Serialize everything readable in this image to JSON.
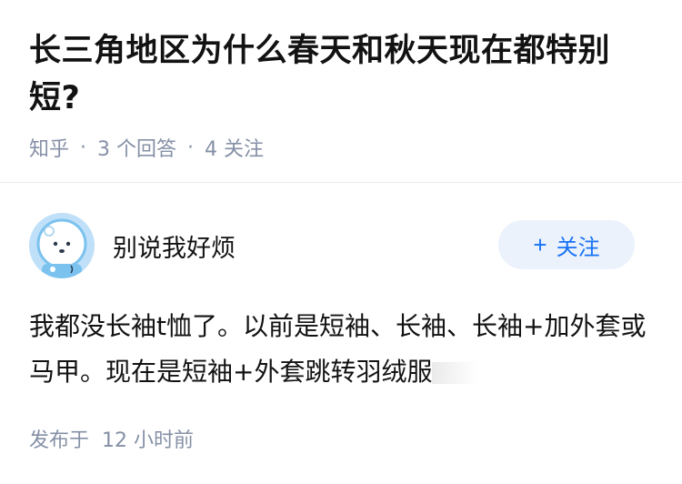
{
  "question": {
    "title": "长三角地区为什么春天和秋天现在都特别短?",
    "source": "知乎",
    "answer_count": "3 个回答",
    "follow_count": "4 关注"
  },
  "author": {
    "name": "别说我好烦",
    "follow_label": "关注",
    "follow_icon": "plus-icon",
    "avatar_icon": "polar-bear-astronaut-avatar"
  },
  "answer": {
    "text": "我都没长袖t恤了。以前是短袖、长袖、长袖+加外套或马甲。现在是短袖+外套跳转羽绒服"
  },
  "footer": {
    "published_label": "发布于",
    "published_time": "12 小时前"
  },
  "colors": {
    "meta_gray": "#8590a6",
    "accent_blue": "#1772f6",
    "follow_bg": "#ebf2fc"
  }
}
